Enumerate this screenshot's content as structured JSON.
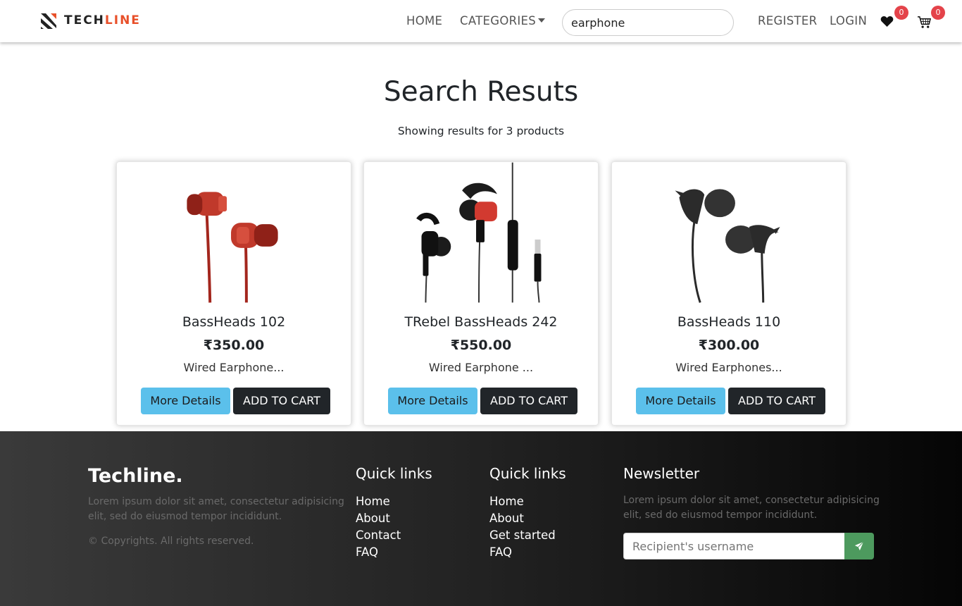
{
  "nav": {
    "brand": {
      "part1": "TECH",
      "part2": "LINE"
    },
    "links": {
      "home": "HOME",
      "categories": "CATEGORIES",
      "register": "REGISTER",
      "login": "LOGIN"
    },
    "search": {
      "value": "earphone",
      "placeholder": "Search"
    },
    "wishlist_count": "0",
    "cart_count": "0"
  },
  "main": {
    "title": "Search Resuts",
    "subtitle": "Showing results for 3 products",
    "products": [
      {
        "name": "BassHeads 102",
        "price": "₹350.00",
        "description": "Wired Earphone...",
        "details_label": "More Details",
        "cart_label": "ADD TO CART"
      },
      {
        "name": "TRebel BassHeads 242",
        "price": "₹550.00",
        "description": "Wired Earphone ...",
        "details_label": "More Details",
        "cart_label": "ADD TO CART"
      },
      {
        "name": "BassHeads 110",
        "price": "₹300.00",
        "description": "Wired Earphones...",
        "details_label": "More Details",
        "cart_label": "ADD TO CART"
      }
    ]
  },
  "footer": {
    "brand": "Techline.",
    "about": "Lorem ipsum dolor sit amet, consectetur adipisicing elit, sed do eiusmod tempor incididunt.",
    "copyright": "© Copyrights. All rights reserved.",
    "col1": {
      "heading": "Quick links",
      "items": [
        "Home",
        "About",
        "Contact",
        "FAQ"
      ]
    },
    "col2": {
      "heading": "Quick links",
      "items": [
        "Home",
        "About",
        "Get started",
        "FAQ"
      ]
    },
    "newsletter": {
      "heading": "Newsletter",
      "text": "Lorem ipsum dolor sit amet, consectetur adipisicing elit, sed do eiusmod tempor incididunt.",
      "placeholder": "Recipient's username"
    }
  },
  "colors": {
    "accent": "#e8502a",
    "info": "#5bc0eb",
    "dark": "#212529",
    "badge": "#e4434a",
    "send": "#4d9a5e"
  },
  "icons": [
    "techline-logo-icon",
    "heart-icon",
    "cart-icon",
    "send-icon"
  ]
}
